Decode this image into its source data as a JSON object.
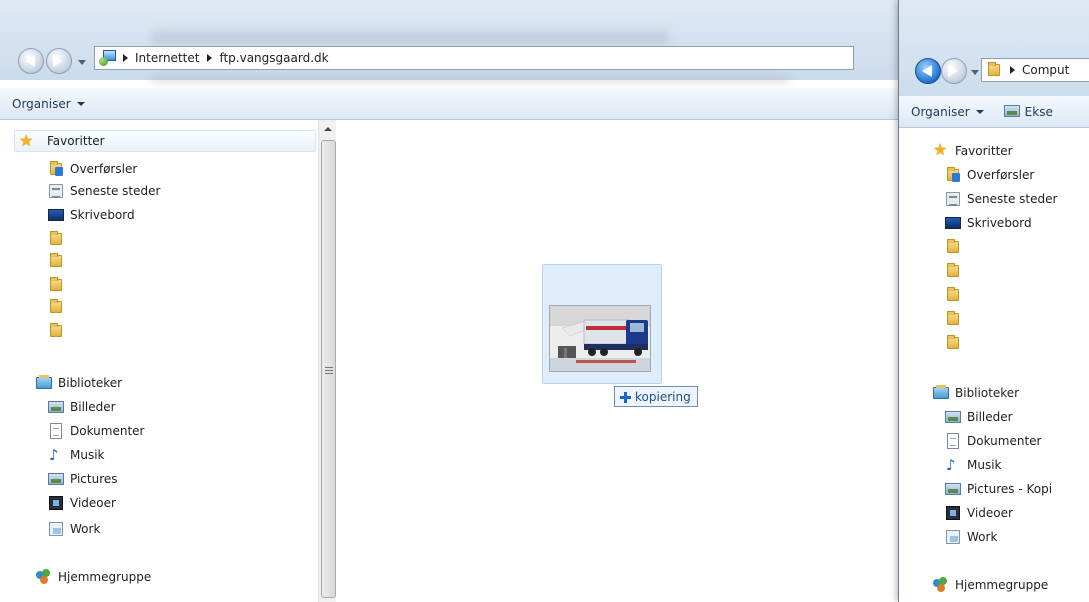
{
  "left_window": {
    "address": {
      "crumbs": [
        "Internettet",
        "ftp.vangsgaard.dk"
      ]
    },
    "toolbar": {
      "organise": "Organiser"
    },
    "favorites": {
      "header": "Favoritter",
      "items": [
        {
          "label": "Overførsler",
          "icon": "downloads-folder-icon"
        },
        {
          "label": "Seneste steder",
          "icon": "recent-places-icon"
        },
        {
          "label": "Skrivebord",
          "icon": "desktop-icon"
        },
        {
          "label": "",
          "icon": "folder-icon"
        },
        {
          "label": "",
          "icon": "folder-icon"
        },
        {
          "label": "",
          "icon": "folder-icon"
        },
        {
          "label": "",
          "icon": "folder-icon"
        },
        {
          "label": "",
          "icon": "folder-icon"
        }
      ]
    },
    "libraries": {
      "header": "Biblioteker",
      "items": [
        {
          "label": "Billeder",
          "icon": "pictures-library-icon"
        },
        {
          "label": "Dokumenter",
          "icon": "documents-library-icon"
        },
        {
          "label": "Musik",
          "icon": "music-library-icon"
        },
        {
          "label": "Pictures",
          "icon": "pictures-library-icon"
        },
        {
          "label": "Videoer",
          "icon": "videos-library-icon"
        },
        {
          "label": "Work",
          "icon": "work-library-icon"
        }
      ]
    },
    "homegroup": {
      "label": "Hjemmegruppe"
    },
    "drag": {
      "tooltip": "kopiering"
    }
  },
  "right_window": {
    "address": {
      "crumbs": [
        "Comput"
      ]
    },
    "toolbar": {
      "organise": "Organiser",
      "extra": "Ekse"
    },
    "favorites": {
      "header": "Favoritter",
      "items": [
        {
          "label": "Overførsler",
          "icon": "downloads-folder-icon"
        },
        {
          "label": "Seneste steder",
          "icon": "recent-places-icon"
        },
        {
          "label": "Skrivebord",
          "icon": "desktop-icon"
        },
        {
          "label": "",
          "icon": "folder-icon"
        },
        {
          "label": "",
          "icon": "folder-icon"
        },
        {
          "label": "",
          "icon": "folder-icon"
        },
        {
          "label": "",
          "icon": "folder-icon"
        },
        {
          "label": "",
          "icon": "folder-icon"
        }
      ]
    },
    "libraries": {
      "header": "Biblioteker",
      "items": [
        {
          "label": "Billeder",
          "icon": "pictures-library-icon"
        },
        {
          "label": "Dokumenter",
          "icon": "documents-library-icon"
        },
        {
          "label": "Musik",
          "icon": "music-library-icon"
        },
        {
          "label": "Pictures - Kopi",
          "icon": "pictures-library-icon"
        },
        {
          "label": "Videoer",
          "icon": "videos-library-icon"
        },
        {
          "label": "Work",
          "icon": "work-library-icon"
        }
      ]
    },
    "homegroup": {
      "label": "Hjemmegruppe"
    }
  }
}
